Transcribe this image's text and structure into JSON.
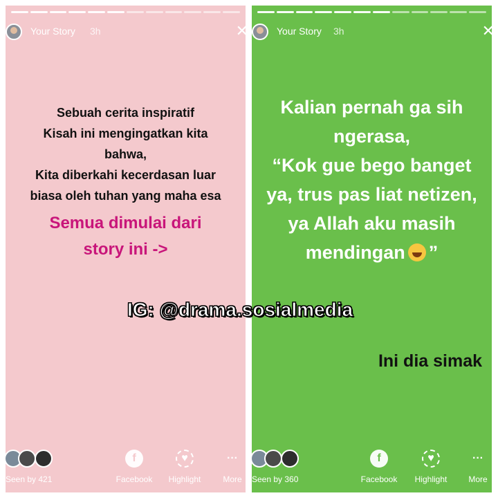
{
  "watermark": "IG: @drama.sosialmedia",
  "stories": [
    {
      "background": "#f4c9cd",
      "header": {
        "username": "Your Story",
        "time": "3h"
      },
      "text_lines": [
        "Sebuah cerita inspiratif",
        "Kisah ini mengingatkan kita",
        "bahwa,",
        "Kita diberkahi kecerdasan luar",
        "biasa oleh tuhan yang maha esa"
      ],
      "accent_lines": [
        "Semua dimulai dari",
        "story ini ->"
      ],
      "accent_color": "#c8157a",
      "seen_by": "Seen by 421",
      "actions": {
        "facebook": "Facebook",
        "highlight": "Highlight",
        "more": "More"
      }
    },
    {
      "background": "#6abf4b",
      "header": {
        "username": "Your Story",
        "time": "3h"
      },
      "text_lines": [
        "Kalian pernah ga sih",
        "ngerasa,",
        "“Kok gue bego banget",
        "ya, trus pas liat netizen,",
        "ya Allah aku masih",
        "mendingan"
      ],
      "closing_quote": "”",
      "emoji": "tears-of-joy-emoji",
      "cta": "Ini dia simak",
      "seen_by": "Seen by 360",
      "actions": {
        "facebook": "Facebook",
        "highlight": "Highlight",
        "more": "More"
      }
    }
  ],
  "icons": {
    "close": "close-icon",
    "facebook": "facebook-icon",
    "highlight": "heart-highlight-icon",
    "more": "more-dots-icon"
  }
}
